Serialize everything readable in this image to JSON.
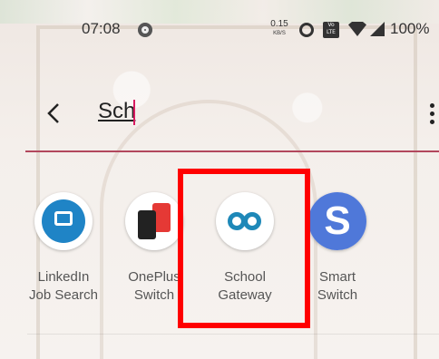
{
  "status_bar": {
    "time": "07:08",
    "net_speed_value": "0.15",
    "net_speed_unit": "KB/S",
    "volte_label": "Vo\nLTE",
    "battery": "100%"
  },
  "search": {
    "query": "Sch"
  },
  "apps": [
    {
      "label": "LinkedIn\nJob Search",
      "icon": "linkedin-icon"
    },
    {
      "label": "OnePlus\nSwitch",
      "icon": "oneplus-switch-icon"
    },
    {
      "label": "School\nGateway",
      "icon": "school-gateway-icon"
    },
    {
      "label": "Smart\nSwitch",
      "icon": "smart-switch-icon",
      "glyph": "S"
    }
  ],
  "colors": {
    "accent": "#d81b60",
    "highlight": "#ff0000",
    "linkedin": "#1f84c6",
    "school_gateway": "#1e88b8",
    "smart_switch": "#4f78d9"
  }
}
